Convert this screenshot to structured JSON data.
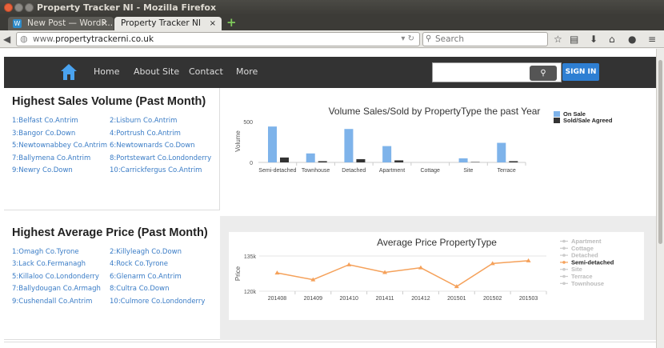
{
  "window": {
    "title": "Property Tracker NI - Mozilla Firefox"
  },
  "tabs": [
    {
      "label": "New Post — WordP...",
      "favicon": "W",
      "close": "×"
    },
    {
      "label": "Property Tracker NI",
      "close": "×"
    }
  ],
  "newtab_icon": "+",
  "navbar": {
    "url_prefix": "www.",
    "url_domain": "propertytrackerni.co.uk",
    "search_placeholder": "Search",
    "icons": [
      "star-icon",
      "bookmarks-icon",
      "download-icon",
      "home-icon",
      "chat-icon",
      "menu-icon"
    ]
  },
  "site": {
    "nav": [
      "Home",
      "About Site",
      "Contact",
      "More"
    ],
    "signin": "SIGN IN",
    "brand_color": "#2e7fd3"
  },
  "sales": {
    "heading": "Highest Sales Volume (Past Month)",
    "col1": [
      "1:Belfast Co.Antrim",
      "3:Bangor Co.Down",
      "5:Newtownabbey Co.Antrim",
      "7:Ballymena Co.Antrim",
      "9:Newry Co.Down"
    ],
    "col2": [
      "2:Lisburn Co.Antrim",
      "4:Portrush Co.Antrim",
      "6:Newtownards Co.Down",
      "8:Portstewart Co.Londonderry",
      "10:Carrickfergus Co.Antrim"
    ]
  },
  "price": {
    "heading": "Highest Average Price (Past Month)",
    "col1": [
      "1:Omagh Co.Tyrone",
      "3:Lack Co.Fermanagh",
      "5:Killaloo Co.Londonderry",
      "7:Ballydougan Co.Armagh",
      "9:Cushendall Co.Antrim"
    ],
    "col2": [
      "2:Killyleagh Co.Down",
      "4:Rock Co.Tyrone",
      "6:Glenarm Co.Antrim",
      "8:Cultra Co.Down",
      "10:Culmore Co.Londonderry"
    ]
  },
  "chart_data": [
    {
      "type": "bar",
      "title": "Volume Sales/Sold by PropertyType the past Year",
      "ylabel": "Volume",
      "ylim": [
        0,
        520
      ],
      "yticks": [
        0,
        500
      ],
      "categories": [
        "Semi-detached",
        "Townhouse",
        "Detached",
        "Apartment",
        "Cottage",
        "Site",
        "Terrace"
      ],
      "series": [
        {
          "name": "On Sale",
          "color": "#7eb3ea",
          "values": [
            440,
            110,
            410,
            200,
            0,
            50,
            240
          ]
        },
        {
          "name": "Sold/Sale Agreed",
          "color": "#333333",
          "values": [
            60,
            15,
            40,
            25,
            0,
            5,
            15
          ]
        }
      ],
      "legend": "top-right"
    },
    {
      "type": "line",
      "title": "Average Price PropertyType",
      "ylabel": "Price",
      "ytick_labels": [
        "135k",
        "120k"
      ],
      "yticks": [
        135000,
        120000
      ],
      "ylim": [
        120000,
        135000
      ],
      "x": [
        "201408",
        "201409",
        "201410",
        "201411",
        "201412",
        "201501",
        "201502",
        "201503"
      ],
      "series": [
        {
          "name": "Semi-detached",
          "color": "#f5a15a",
          "values": [
            127800,
            124900,
            131300,
            128000,
            130000,
            122000,
            131800,
            133000
          ]
        }
      ],
      "legend_items": [
        "Apartment",
        "Cottage",
        "Detached",
        "Semi-detached",
        "Site",
        "Terrace",
        "Townhouse"
      ],
      "legend_active": "Semi-detached",
      "legend": "right"
    }
  ]
}
